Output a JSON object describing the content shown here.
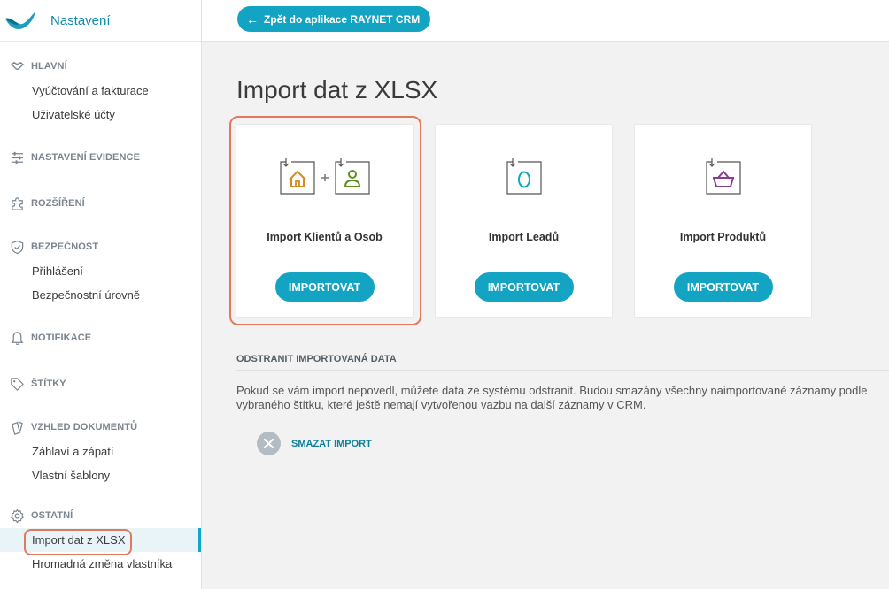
{
  "app": {
    "title": "Nastavení",
    "back_button_label": "Zpět do aplikace RAYNET CRM"
  },
  "sidebar": {
    "sections": [
      {
        "icon": "handshake-icon",
        "title": "HLAVNÍ",
        "items": [
          "Vyúčtování a fakturace",
          "Uživatelské účty"
        ]
      },
      {
        "icon": "sliders-icon",
        "title": "NASTAVENÍ EVIDENCE",
        "items": []
      },
      {
        "icon": "puzzle-icon",
        "title": "ROZŠÍŘENÍ",
        "items": []
      },
      {
        "icon": "shield-icon",
        "title": "BEZPEČNOST",
        "items": [
          "Přihlášení",
          "Bezpečnostní úrovně"
        ]
      },
      {
        "icon": "bell-icon",
        "title": "NOTIFIKACE",
        "items": []
      },
      {
        "icon": "tag-icon",
        "title": "ŠTÍTKY",
        "items": []
      },
      {
        "icon": "documents-icon",
        "title": "VZHLED DOKUMENTŮ",
        "items": [
          "Záhlaví a zápatí",
          "Vlastní šablony"
        ]
      },
      {
        "icon": "gear-icon",
        "title": "OSTATNÍ",
        "items": [
          "Import dat z XLSX",
          "Hromadná změna vlastníka"
        ]
      }
    ],
    "active_item": "Import dat z XLSX"
  },
  "main": {
    "title": "Import dat z XLSX",
    "cards": [
      {
        "label": "Import Klientů a Osob",
        "button": "IMPORTOVAT",
        "icon": "import-clients-persons-icon"
      },
      {
        "label": "Import Leadů",
        "button": "IMPORTOVAT",
        "icon": "import-leads-icon"
      },
      {
        "label": "Import Produktů",
        "button": "IMPORTOVAT",
        "icon": "import-products-icon"
      }
    ],
    "delete_section": {
      "title": "ODSTRANIT IMPORTOVANÁ DATA",
      "text": "Pokud se vám import nepovedl, můžete data ze systému odstranit. Budou smazány všechny naimportované záznamy podle vybraného štítku, které ještě nemají vytvořenou vazbu na další záznamy v CRM.",
      "button": "SMAZAT IMPORT"
    }
  },
  "colors": {
    "accent": "#13a3c3",
    "highlight": "#e07a5f",
    "brand_text": "#0f8aa8"
  }
}
